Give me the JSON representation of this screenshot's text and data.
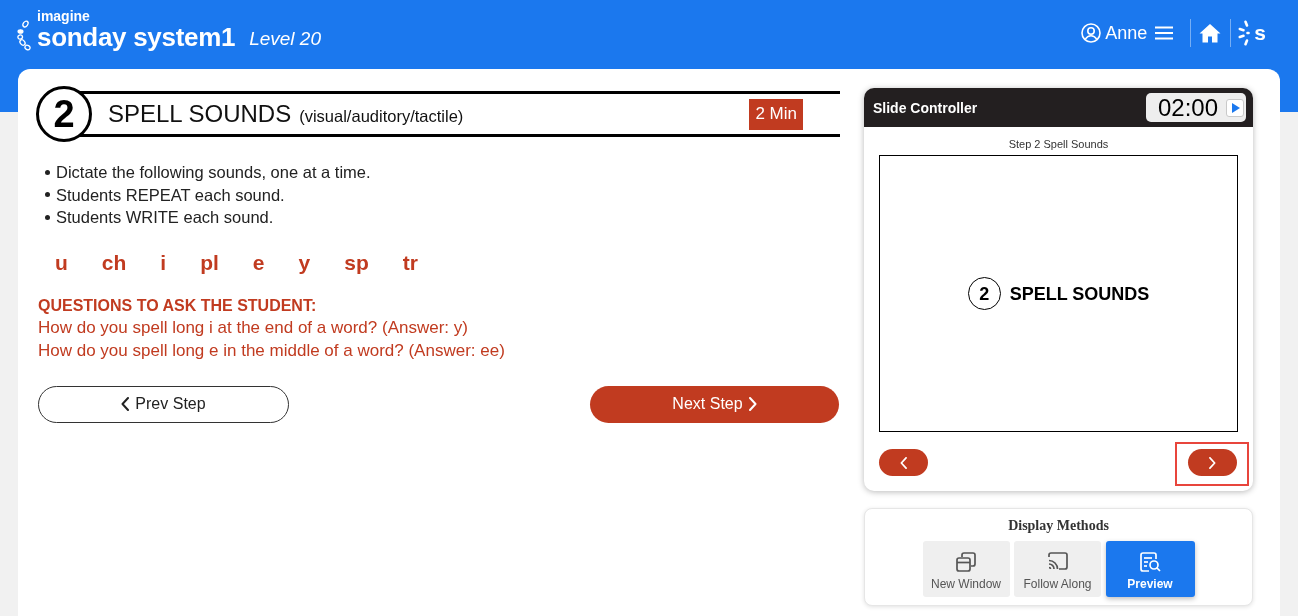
{
  "header": {
    "brand_small": "imagine",
    "brand_name": "sonday system1",
    "level": "Level 20",
    "user_name": "Anne",
    "app_letter": "s"
  },
  "step": {
    "number": "2",
    "title": "SPELL SOUNDS",
    "subtitle": "(visual/auditory/tactile)",
    "duration": "2 Min"
  },
  "instructions": [
    "Dictate the following sounds, one at a time.",
    "Students REPEAT each sound.",
    "Students WRITE each sound."
  ],
  "sounds": [
    "u",
    "ch",
    "i",
    "pl",
    "e",
    "y",
    "sp",
    "tr"
  ],
  "questions": {
    "heading": "QUESTIONS TO ASK THE STUDENT:",
    "items": [
      "How do you spell long i at the end of a word? (Answer: y)",
      "How do you spell long e in the middle of a word? (Answer: ee)"
    ]
  },
  "step_buttons": [
    {
      "kind": "prev",
      "label": "Prev Step"
    },
    {
      "kind": "next",
      "label": "Next Step"
    }
  ],
  "slide_controller": {
    "title": "Slide Controller",
    "timer": "02:00",
    "caption": "Step 2 Spell Sounds",
    "slide": {
      "number": "2",
      "title": "SPELL SOUNDS"
    },
    "nav_buttons": [
      {
        "kind": "prev",
        "highlighted": false
      },
      {
        "kind": "next",
        "highlighted": true
      }
    ]
  },
  "display_methods": {
    "title": "Display Methods",
    "options": [
      {
        "kind": "window",
        "label": "New Window",
        "selected": false
      },
      {
        "kind": "cast",
        "label": "Follow Along",
        "selected": false
      },
      {
        "kind": "preview",
        "label": "Preview",
        "selected": true
      }
    ]
  }
}
